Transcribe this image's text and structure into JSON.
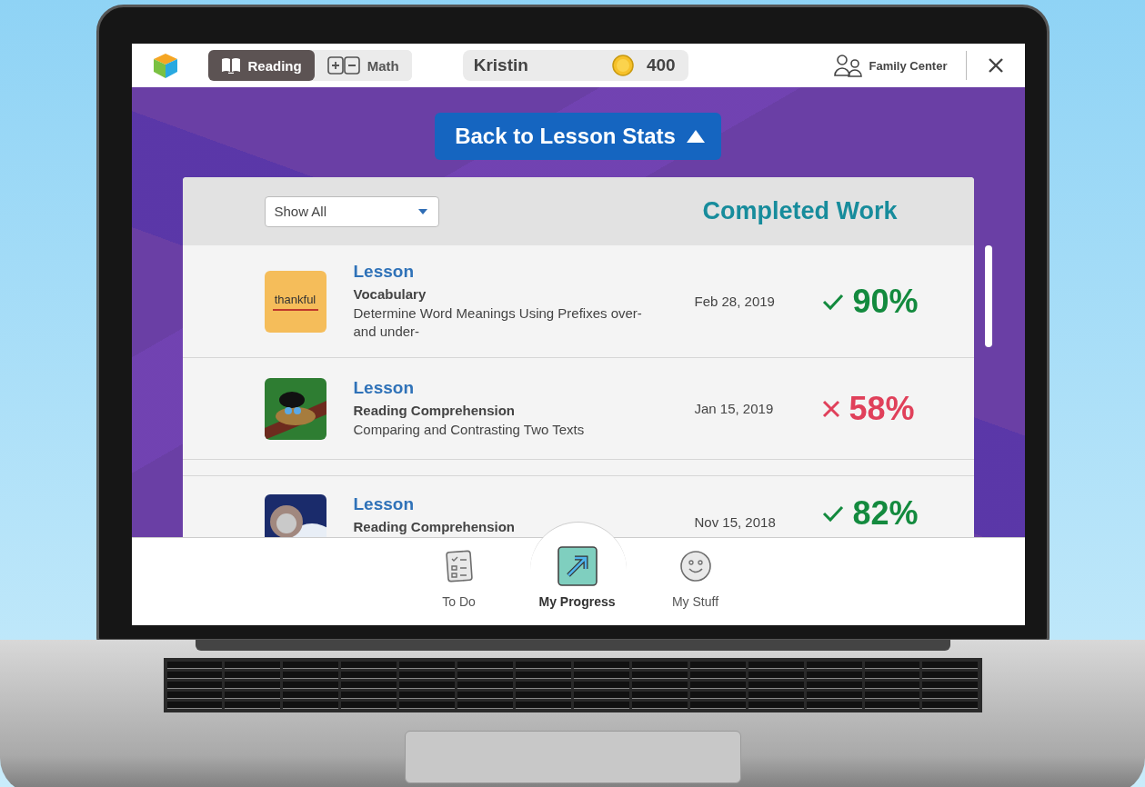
{
  "top_bar": {
    "subjects": [
      {
        "label": "Reading",
        "kind": "book",
        "selected": true
      },
      {
        "label": "Math",
        "kind": "plusminus",
        "selected": false
      }
    ],
    "student": {
      "name": "Kristin",
      "coins": "400"
    },
    "family_center": "Family Center"
  },
  "back_button": "Back to Lesson Stats",
  "panel": {
    "filter": {
      "value": "Show All"
    },
    "title": "Completed Work",
    "rows": [
      {
        "kind": "pass",
        "type": "Lesson",
        "thumbnail": {
          "kind": "word",
          "text": "thankful"
        },
        "subject": "Vocabulary",
        "description": "Determine Word Meanings Using Prefixes over- and under-",
        "date": "Feb 28, 2019",
        "score": "90%"
      },
      {
        "kind": "fail",
        "type": "Lesson",
        "thumbnail": {
          "kind": "bird"
        },
        "subject": "Reading Comprehension",
        "description": "Comparing and Contrasting Two Texts",
        "date": "Jan 15, 2019",
        "score": "58%"
      },
      {
        "kind": "pass",
        "type": "Lesson",
        "thumbnail": {
          "kind": "person"
        },
        "subject": "Reading Comprehension",
        "date": "Nov 15, 2018",
        "score": "82%"
      }
    ]
  },
  "bottom_nav": [
    {
      "label": "To Do",
      "kind": "list",
      "selected": false
    },
    {
      "label": "My Progress",
      "kind": "progress",
      "selected": true
    },
    {
      "label": "My Stuff",
      "kind": "smile",
      "selected": false
    }
  ]
}
